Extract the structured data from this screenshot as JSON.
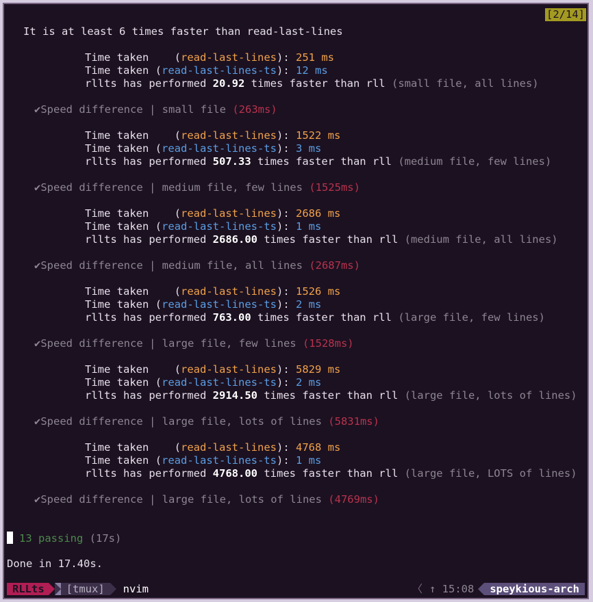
{
  "counter": "[2/14]",
  "intro": "It is at least 6 times faster than read-last-lines",
  "labels": {
    "time_taken": "Time taken",
    "rll_name": "read-last-lines",
    "rllts_name": "read-last-lines-ts",
    "ms": "ms",
    "performed_prefix": "rllts has performed",
    "performed_suffix": "times faster than rll",
    "check": "✔",
    "speed_prefix": "Speed difference | "
  },
  "results": [
    {
      "rll": "251",
      "rllts": "12",
      "factor": "20.92",
      "scenario": "(small file, all lines)",
      "test_name": "small file",
      "test_time": "(263ms)"
    },
    {
      "rll": "1522",
      "rllts": "3",
      "factor": "507.33",
      "scenario": "(medium file, few lines)",
      "test_name": "medium file, few lines",
      "test_time": "(1525ms)"
    },
    {
      "rll": "2686",
      "rllts": "1",
      "factor": "2686.00",
      "scenario": "(medium file, all lines)",
      "test_name": "medium file, all lines",
      "test_time": "(2687ms)"
    },
    {
      "rll": "1526",
      "rllts": "2",
      "factor": "763.00",
      "scenario": "(large file, few lines)",
      "test_name": "large file, few lines",
      "test_time": "(1528ms)"
    },
    {
      "rll": "5829",
      "rllts": "2",
      "factor": "2914.50",
      "scenario": "(large file, lots of lines)",
      "test_name": "large file, lots of lines",
      "test_time": "(5831ms)"
    },
    {
      "rll": "4768",
      "rllts": "1",
      "factor": "4768.00",
      "scenario": "(large file, LOTS of lines)",
      "test_name": "large file, lots of lines",
      "test_time": "(4769ms)"
    }
  ],
  "summary": {
    "passing": "13 passing",
    "duration": "(17s)"
  },
  "done": "Done in 17.40s.",
  "statusbar": {
    "session": "RLLts",
    "window_tmux": "[tmux]",
    "window_nvim": "nvim",
    "clock_icon": "↑",
    "time": "15:08",
    "host": "speykious-arch"
  },
  "colors": {
    "background": "#1c1121",
    "orange": "#f0a24a",
    "blue": "#5b9ee3",
    "red": "#b8334d",
    "green": "#4c8a4c",
    "counter_bg": "#a39a22",
    "session_bg": "#b01e54",
    "host_bg": "#5c4f7a"
  }
}
